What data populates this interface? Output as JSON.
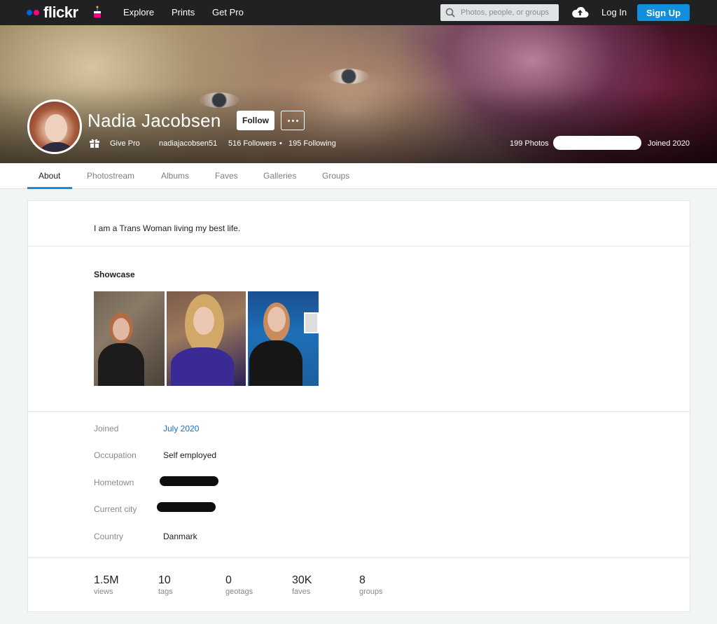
{
  "nav": {
    "brand": "flickr",
    "links": [
      "Explore",
      "Prints",
      "Get Pro"
    ],
    "search_placeholder": "Photos, people, or groups",
    "login": "Log In",
    "signup": "Sign Up",
    "colors": {
      "bar": "#212124",
      "logo_blue": "#0063dc",
      "logo_pink": "#ff0084",
      "signup": "#128fdc"
    }
  },
  "profile": {
    "name": "Nadia Jacobsen",
    "follow": "Follow",
    "give_pro": "Give Pro",
    "username": "nadiajacobsen51",
    "followers": "516 Followers",
    "separator": "•",
    "following": "195 Following",
    "photos": "199 Photos",
    "joined": "Joined 2020"
  },
  "tabs": [
    "About",
    "Photostream",
    "Albums",
    "Faves",
    "Galleries",
    "Groups"
  ],
  "about": {
    "bio": "I am a Trans Woman living my best life.",
    "showcase_title": "Showcase",
    "info": [
      {
        "label": "Joined",
        "value": "July 2020"
      },
      {
        "label": "Occupation",
        "value": "Self employed"
      },
      {
        "label": "Hometown",
        "value": ""
      },
      {
        "label": "Current city",
        "value": ""
      },
      {
        "label": "Country",
        "value": "Danmark"
      }
    ],
    "stats": [
      {
        "num": "1.5M",
        "label": "views"
      },
      {
        "num": "10",
        "label": "tags"
      },
      {
        "num": "0",
        "label": "geotags"
      },
      {
        "num": "30K",
        "label": "faves"
      },
      {
        "num": "8",
        "label": "groups"
      }
    ]
  }
}
